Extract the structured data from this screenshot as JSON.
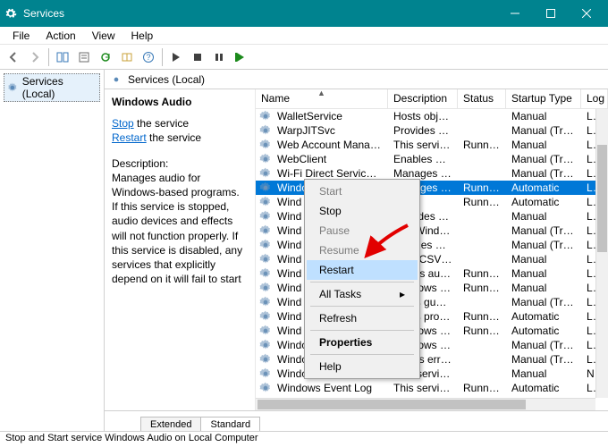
{
  "window": {
    "title": "Services"
  },
  "menubar": [
    "File",
    "Action",
    "View",
    "Help"
  ],
  "tree": {
    "root": "Services (Local)"
  },
  "header": {
    "label": "Services (Local)"
  },
  "detail": {
    "service_name": "Windows Audio",
    "action_stop": "Stop",
    "action_stop_suffix": " the service",
    "action_restart": "Restart",
    "action_restart_suffix": " the service",
    "desc_label": "Description:",
    "description": "Manages audio for Windows-based programs.  If this service is stopped, audio devices and effects will not function properly.  If this service is disabled, any services that explicitly depend on it will fail to start"
  },
  "columns": {
    "name": "Name",
    "description": "Description",
    "status": "Status",
    "startup": "Startup Type",
    "logon": "Log"
  },
  "rows": [
    {
      "name": "WalletService",
      "desc": "Hosts objec...",
      "status": "",
      "start": "Manual",
      "log": "Loc"
    },
    {
      "name": "WarpJITSvc",
      "desc": "Provides a JI...",
      "status": "",
      "start": "Manual (Trig...",
      "log": "Loc"
    },
    {
      "name": "Web Account Manager",
      "desc": "This service ...",
      "status": "Running",
      "start": "Manual",
      "log": "Loc"
    },
    {
      "name": "WebClient",
      "desc": "Enables Win...",
      "status": "",
      "start": "Manual (Trig...",
      "log": "Loc"
    },
    {
      "name": "Wi-Fi Direct Services Conne...",
      "desc": "Manages co...",
      "status": "",
      "start": "Manual (Trig...",
      "log": "Loc"
    },
    {
      "name": "Windows Audio",
      "desc": "Manages au...",
      "status": "Running",
      "start": "Automatic",
      "log": "Loc",
      "selected": true
    },
    {
      "name": "Wind",
      "desc": "",
      "status": "Running",
      "start": "Automatic",
      "log": "Loc"
    },
    {
      "name": "Wind",
      "desc": "Provides Wi...",
      "status": "",
      "start": "Manual",
      "log": "Loc"
    },
    {
      "name": "Wind",
      "desc": "The Windo...",
      "status": "",
      "start": "Manual (Trig...",
      "log": "Loc"
    },
    {
      "name": "Wind",
      "desc": "Enables mul...",
      "status": "",
      "start": "Manual (Trig...",
      "log": "Loc"
    },
    {
      "name": "Wind",
      "desc": "WCNCSVC ...",
      "status": "",
      "start": "Manual",
      "log": "Loc"
    },
    {
      "name": "Wind",
      "desc": "Makes auto...",
      "status": "Running",
      "start": "Manual",
      "log": "Loc"
    },
    {
      "name": "Wind",
      "desc": "Windows D...",
      "status": "Running",
      "start": "Manual",
      "log": "Loc"
    },
    {
      "name": "Wind",
      "desc": "Helps guard...",
      "status": "",
      "start": "Manual (Trig...",
      "log": "Loc"
    },
    {
      "name": "Wind",
      "desc": "Helps prote...",
      "status": "Running",
      "start": "Automatic",
      "log": "Loc"
    },
    {
      "name": "Wind",
      "desc": "Windows D...",
      "status": "Running",
      "start": "Automatic",
      "log": "Loc"
    },
    {
      "name": "Windows Encryption Provid...",
      "desc": "Windows E...",
      "status": "",
      "start": "Manual (Trig...",
      "log": "Loc"
    },
    {
      "name": "Windows Error Reporting Se...",
      "desc": "Allows error...",
      "status": "",
      "start": "Manual (Trig...",
      "log": "Loc"
    },
    {
      "name": "Windows Event Collector",
      "desc": "This service ...",
      "status": "",
      "start": "Manual",
      "log": "Net"
    },
    {
      "name": "Windows Event Log",
      "desc": "This service ...",
      "status": "Running",
      "start": "Automatic",
      "log": "Loc"
    }
  ],
  "context_menu": {
    "start": "Start",
    "stop": "Stop",
    "pause": "Pause",
    "resume": "Resume",
    "restart": "Restart",
    "alltasks": "All Tasks",
    "refresh": "Refresh",
    "properties": "Properties",
    "help": "Help"
  },
  "tabs": {
    "extended": "Extended",
    "standard": "Standard"
  },
  "statusbar": "Stop and Start service Windows Audio on Local Computer"
}
